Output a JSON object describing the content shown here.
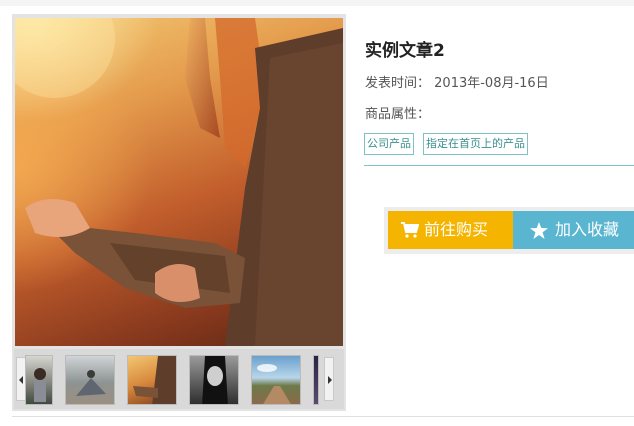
{
  "article": {
    "title": "实例文章2",
    "date_label": "发表时间：",
    "date_value": "2013年-08月-16日",
    "attr_label": "商品属性：",
    "tags": [
      "公司产品",
      "指定在首页上的产品"
    ]
  },
  "actions": {
    "buy_label": "前往购买",
    "favorite_label": "加入收藏",
    "buy_color": "#f5b400",
    "favorite_color": "#5ab5d0"
  },
  "gallery": {
    "main_image": "woman-in-knit-sweater-sunlight",
    "thumbnails": [
      "girl-with-flowers",
      "dancer-on-floor",
      "sunset-hands",
      "woman-portrait-bw",
      "road-under-sky",
      "night-scene"
    ]
  },
  "colors": {
    "accent": "#7ec3c3"
  }
}
